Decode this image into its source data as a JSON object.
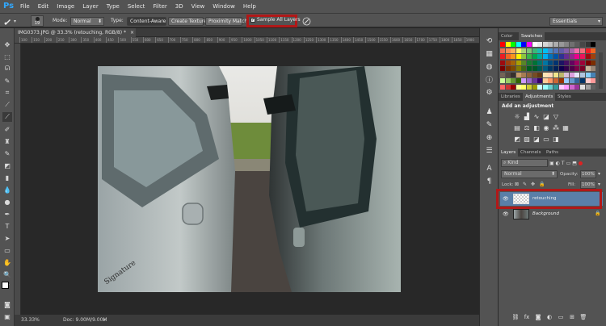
{
  "app": {
    "logo": "Ps"
  },
  "menu": [
    "File",
    "Edit",
    "Image",
    "Layer",
    "Type",
    "Select",
    "Filter",
    "3D",
    "View",
    "Window",
    "Help"
  ],
  "options": {
    "brush_size": "19",
    "mode_label": "Mode:",
    "mode_value": "Normal",
    "type_label": "Type:",
    "type_content_aware": "Content-Aware",
    "type_create_texture": "Create Texture",
    "type_proximity_match": "Proximity Match",
    "sample_all_layers": "Sample All Layers",
    "sample_all_layers_checked": true,
    "workspace": "Essentials"
  },
  "document": {
    "tab_title": "IMG0373.JPG @ 33.3% (retouching, RGB/8) *",
    "zoom": "33.33%",
    "doc_info": "Doc: 9.00M/9.00M",
    "ruler_ticks": [
      "100",
      "150",
      "200",
      "250",
      "300",
      "350",
      "400",
      "450",
      "500",
      "550",
      "600",
      "650",
      "700",
      "750",
      "800",
      "850",
      "900",
      "950",
      "1000",
      "1050",
      "1100",
      "1150",
      "1200",
      "1250",
      "1300",
      "1350",
      "1400",
      "1450",
      "1500",
      "1550",
      "1600",
      "1650",
      "1700",
      "1750",
      "1800",
      "1850",
      "1900"
    ]
  },
  "panels": {
    "color_tabs": [
      "Color",
      "Swatches"
    ],
    "adjust_tabs": [
      "Libraries",
      "Adjustments",
      "Styles"
    ],
    "add_adjustment": "Add an adjustment",
    "layers_tabs": [
      "Layers",
      "Channels",
      "Paths"
    ],
    "kind_label": "Kind",
    "blend_mode": "Normal",
    "opacity_label": "Opacity:",
    "opacity_value": "100%",
    "lock_label": "Lock:",
    "fill_label": "Fill:",
    "fill_value": "100%",
    "layers": [
      {
        "name": "retouching",
        "selected": true
      },
      {
        "name": "Background",
        "selected": false,
        "locked": true
      }
    ]
  },
  "colors": {
    "accent_highlight": "#b01818",
    "selected_layer": "#5a7fa8",
    "ps_blue": "#31a8ff"
  }
}
